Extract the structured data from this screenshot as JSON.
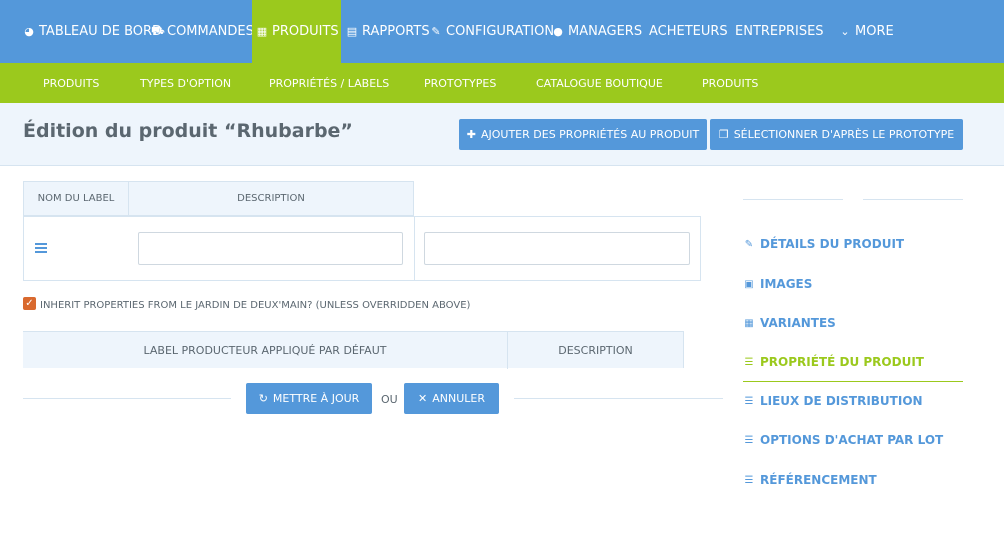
{
  "topnav": {
    "items": [
      {
        "label": "TABLEAU DE BORD",
        "icon": "dashboard-icon"
      },
      {
        "label": "COMMANDES",
        "icon": "cart-icon"
      },
      {
        "label": "PRODUITS",
        "icon": "grid-icon",
        "active": true
      },
      {
        "label": "RAPPORTS",
        "icon": "file-icon"
      },
      {
        "label": "CONFIGURATION",
        "icon": "wrench-icon"
      },
      {
        "label": "MANAGERS",
        "icon": "user-icon"
      },
      {
        "label": "ACHETEURS"
      },
      {
        "label": "ENTREPRISES"
      },
      {
        "label": "MORE",
        "icon": "chevron-down-icon"
      }
    ]
  },
  "subnav": {
    "items": [
      "PRODUITS",
      "TYPES D'OPTION",
      "PROPRIÉTÉS / LABELS",
      "PROTOTYPES",
      "CATALOGUE BOUTIQUE",
      "PRODUITS"
    ]
  },
  "header": {
    "title": "Édition du produit “Rhubarbe”",
    "add_properties_label": "AJOUTER DES PROPRIÉTÉS AU PRODUIT",
    "select_prototype_label": "SÉLECTIONNER D'APRÈS LE PROTOTYPE"
  },
  "properties_table": {
    "columns": [
      "NOM DU LABEL",
      "DESCRIPTION"
    ],
    "row": {
      "label_value": "",
      "description_value": ""
    }
  },
  "inherit": {
    "checked": true,
    "label": "INHERIT PROPERTIES FROM LE JARDIN DE DEUX'MAIN? (UNLESS OVERRIDDEN ABOVE)"
  },
  "producer_table": {
    "columns": [
      "LABEL PRODUCTEUR APPLIQUÉ PAR DÉFAUT",
      "DESCRIPTION"
    ]
  },
  "actions": {
    "update_label": "METTRE À JOUR",
    "or_label": "OU",
    "cancel_label": "ANNULER"
  },
  "sidebar": {
    "items": [
      {
        "label": "DÉTAILS DU PRODUIT",
        "icon": "edit-icon"
      },
      {
        "label": "IMAGES",
        "icon": "image-icon"
      },
      {
        "label": "VARIANTES",
        "icon": "grid-icon"
      },
      {
        "label": "PROPRIÉTÉ DU PRODUIT",
        "icon": "list-icon",
        "active": true
      },
      {
        "label": "LIEUX DE DISTRIBUTION",
        "icon": "list-icon"
      },
      {
        "label": "OPTIONS D'ACHAT PAR LOT",
        "icon": "list-icon"
      },
      {
        "label": "RÉFÉRENCEMENT",
        "icon": "list-icon"
      }
    ]
  },
  "colors": {
    "primary": "#5498da",
    "accent": "#9bc91d",
    "checkbox": "#d9692e"
  }
}
